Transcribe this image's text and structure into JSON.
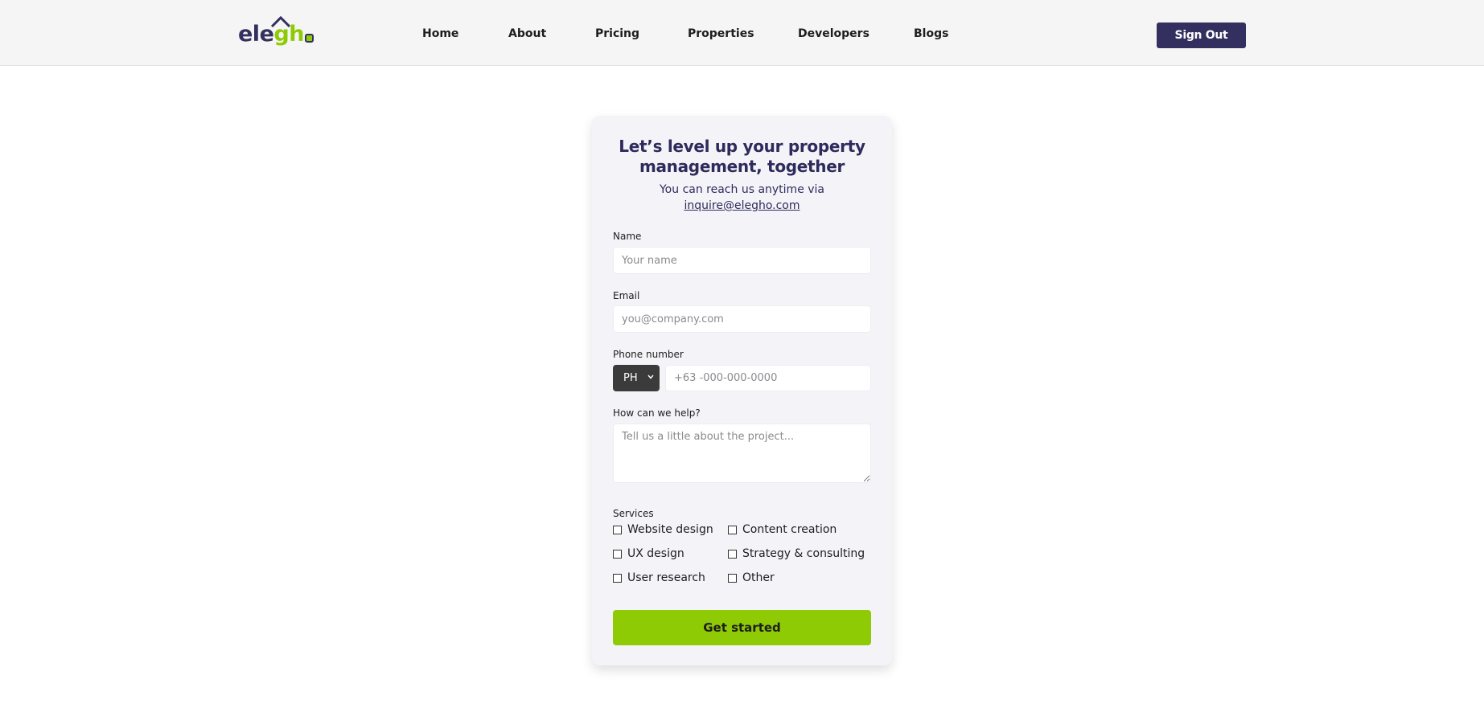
{
  "brand": {
    "logo_part1": "ele",
    "logo_part2": "gh",
    "accent": "#8fcb05",
    "primary": "#33305f"
  },
  "nav": {
    "items": [
      {
        "label": "Home"
      },
      {
        "label": "About"
      },
      {
        "label": "Pricing"
      },
      {
        "label": "Properties"
      },
      {
        "label": "Developers"
      },
      {
        "label": "Blogs"
      }
    ],
    "signout_label": "Sign Out"
  },
  "form": {
    "title_line1": "Let’s level up your property",
    "title_line2": "management, together",
    "subtitle": "You can reach us anytime via",
    "email_link": "inquire@elegho.com",
    "name": {
      "label": "Name",
      "placeholder": "Your name"
    },
    "email": {
      "label": "Email",
      "placeholder": "you@company.com"
    },
    "phone": {
      "label": "Phone number",
      "country_code": "PH",
      "placeholder": "+63 -000-000-0000"
    },
    "help": {
      "label": "How can we help?",
      "placeholder": "Tell us a little about the project..."
    },
    "services": {
      "label": "Services",
      "options": [
        {
          "label": "Website design",
          "checked": false
        },
        {
          "label": "Content creation",
          "checked": false
        },
        {
          "label": "UX design",
          "checked": false
        },
        {
          "label": "Strategy & consulting",
          "checked": false
        },
        {
          "label": "User research",
          "checked": false
        },
        {
          "label": "Other",
          "checked": false
        }
      ]
    },
    "submit_label": "Get started"
  }
}
